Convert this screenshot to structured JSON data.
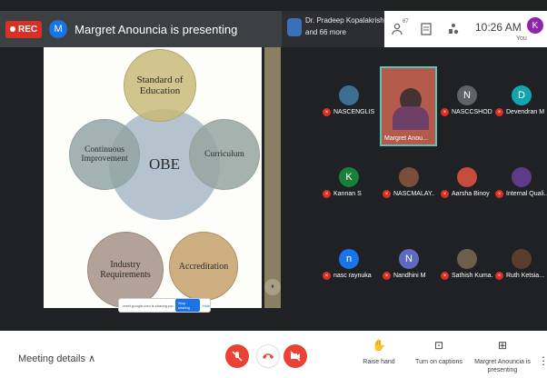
{
  "topbar": {
    "rec_label": "REC",
    "presenter_initial": "M",
    "presenting_text": "Margret Anouncia is presenting",
    "host_name": "Dr. Pradeep Kopalakrish...",
    "host_more": "and 66 more",
    "participant_count_badge": "67",
    "time": "10:26 AM",
    "you_initial": "K",
    "you_label": "You"
  },
  "slide": {
    "center": "OBE",
    "top": "Standard of Education",
    "left": "Continuous Improvement",
    "right": "Curriculum",
    "bottom_left": "Industry Requirements",
    "bottom_right": "Accreditation",
    "share_text": "meet.google.com is sharing your screen.",
    "stop_sharing": "Stop sharing",
    "hide": "Hide"
  },
  "participants": [
    {
      "name": "NASCENGLIS...",
      "initial": "",
      "color": "#3c6e8f",
      "photo": true
    },
    {
      "name": "Margret Anou...",
      "video": true
    },
    {
      "name": "NASCCSHOD ...",
      "initial": "N",
      "color": "#5f6368"
    },
    {
      "name": "Devendran M",
      "initial": "D",
      "color": "#12a4af"
    },
    {
      "name": "Kannan S",
      "initial": "K",
      "color": "#188038"
    },
    {
      "name": "NASCMALAY...",
      "initial": "",
      "color": "#7b4e3a",
      "photo": true
    },
    {
      "name": "Aarsha Binoy",
      "initial": "",
      "color": "#c74b3b",
      "photo": true
    },
    {
      "name": "Internal Quali...",
      "initial": "",
      "color": "#5d3a8a",
      "photo": true
    },
    {
      "name": "nasc raynuka",
      "initial": "n",
      "color": "#1a73e8"
    },
    {
      "name": "Nandhini M",
      "initial": "N",
      "color": "#5c6bc0"
    },
    {
      "name": "Sathish Kuma...",
      "initial": "",
      "color": "#6d5d4d",
      "photo": true
    },
    {
      "name": "Ruth Ketsia...",
      "initial": "",
      "color": "#5a3e2b",
      "photo": true
    }
  ],
  "bottombar": {
    "meeting_details": "Meeting details",
    "raise_hand": "Raise hand",
    "captions": "Turn on captions",
    "presenting": "Margret Anouncia is presenting"
  }
}
